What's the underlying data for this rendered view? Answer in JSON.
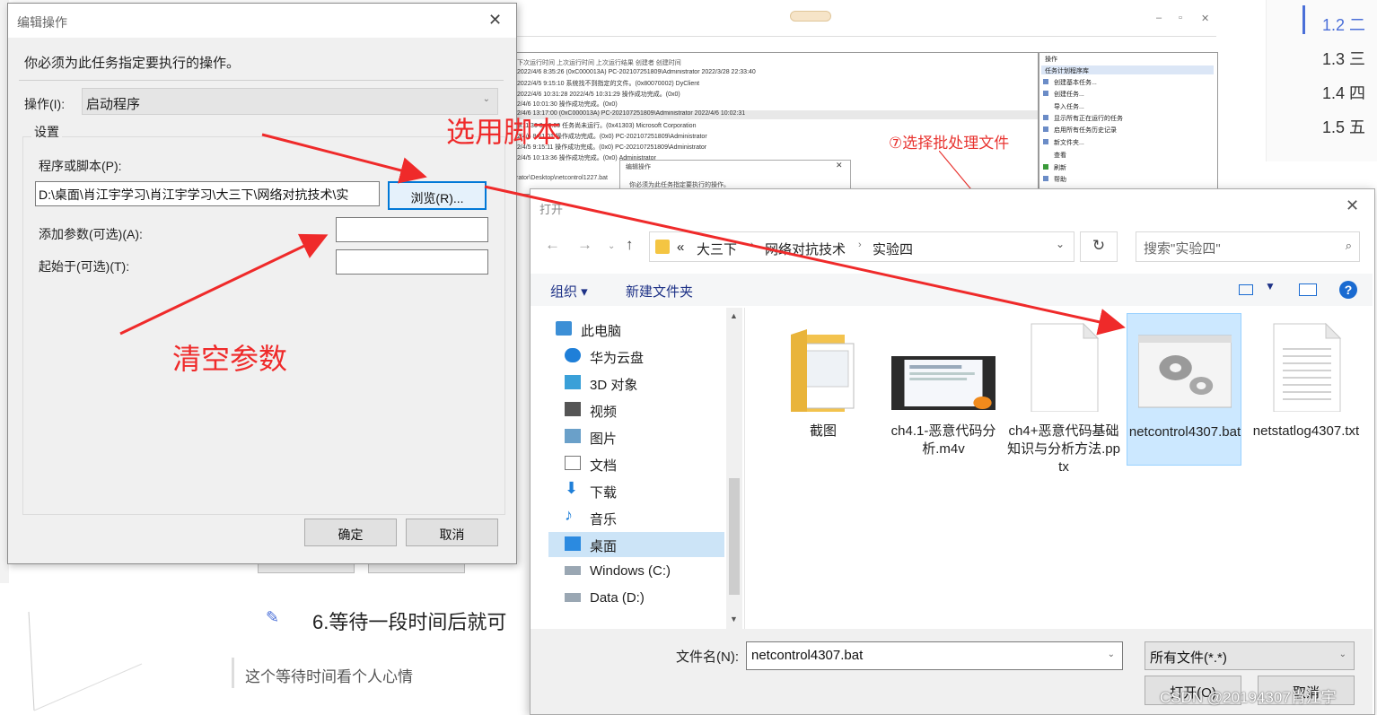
{
  "background": {
    "toc": [
      {
        "num": "1.2",
        "text": "二",
        "active": true
      },
      {
        "num": "1.3",
        "text": "三",
        "active": false
      },
      {
        "num": "1.4",
        "text": "四",
        "active": false
      },
      {
        "num": "1.5",
        "text": "五",
        "active": false
      }
    ],
    "scheduler_annotation": "⑦选择批处理文件",
    "small_dialog_title": "编辑操作",
    "small_dialog_msg": "你必须为此任务指定要执行的操作。",
    "small_path": "rator\\Desktop\\netcontrol1227.bat",
    "blog_heading": "6.等待一段时间后就可",
    "blog_quote": "这个等待时间看个人心情"
  },
  "edit_dialog": {
    "title": "编辑操作",
    "message": "你必须为此任务指定要执行的操作。",
    "action_label": "操作(I):",
    "action_value": "启动程序",
    "settings_label": "设置",
    "program_label": "程序或脚本(P):",
    "program_value": "D:\\桌面\\肖江宇学习\\肖江宇学习\\大三下\\网络对抗技术\\实",
    "browse_label": "浏览(R)...",
    "args_label": "添加参数(可选)(A):",
    "args_value": "",
    "start_label": "起始于(可选)(T):",
    "start_value": "",
    "ok_label": "确定",
    "cancel_label": "取消"
  },
  "open_dialog": {
    "title": "打开",
    "breadcrumb": [
      "«",
      "大三下",
      "网络对抗技术",
      "实验四"
    ],
    "search_placeholder": "搜索\"实验四\"",
    "toolbar": {
      "organize": "组织 ▾",
      "new_folder": "新建文件夹",
      "help": "?"
    },
    "sidebar": [
      {
        "label": "此电脑",
        "icon": "computer-icon",
        "level": 0
      },
      {
        "label": "华为云盘",
        "icon": "cloud-icon",
        "level": 1
      },
      {
        "label": "3D 对象",
        "icon": "cube-icon",
        "level": 1
      },
      {
        "label": "视频",
        "icon": "video-icon",
        "level": 1
      },
      {
        "label": "图片",
        "icon": "picture-icon",
        "level": 1
      },
      {
        "label": "文档",
        "icon": "document-icon",
        "level": 1
      },
      {
        "label": "下载",
        "icon": "download-icon",
        "level": 1
      },
      {
        "label": "音乐",
        "icon": "music-icon",
        "level": 1
      },
      {
        "label": "桌面",
        "icon": "desktop-icon",
        "level": 1,
        "selected": true
      },
      {
        "label": "Windows (C:)",
        "icon": "drive-icon",
        "level": 1
      },
      {
        "label": "Data (D:)",
        "icon": "drive-icon",
        "level": 1
      }
    ],
    "files": [
      {
        "name": "截图",
        "type": "folder"
      },
      {
        "name": "ch4.1-恶意代码分析.m4v",
        "type": "video"
      },
      {
        "name": "ch4+恶意代码基础知识与分析方法.pptx",
        "type": "blank"
      },
      {
        "name": "netcontrol4307.bat",
        "type": "bat",
        "selected": true
      },
      {
        "name": "netstatlog4307.txt",
        "type": "text"
      }
    ],
    "filename_label": "文件名(N):",
    "filename_value": "netcontrol4307.bat",
    "filetype_value": "所有文件(*.*)",
    "open_label": "打开(O)",
    "cancel_label": "取消"
  },
  "annotations": {
    "select_script": "选用脚本",
    "clear_args": "清空参数"
  },
  "watermark": "CSDN @20194307肖江宇",
  "colors": {
    "annotation": "#ef2a2a",
    "selection": "#cce8ff",
    "link": "#1e3287"
  }
}
